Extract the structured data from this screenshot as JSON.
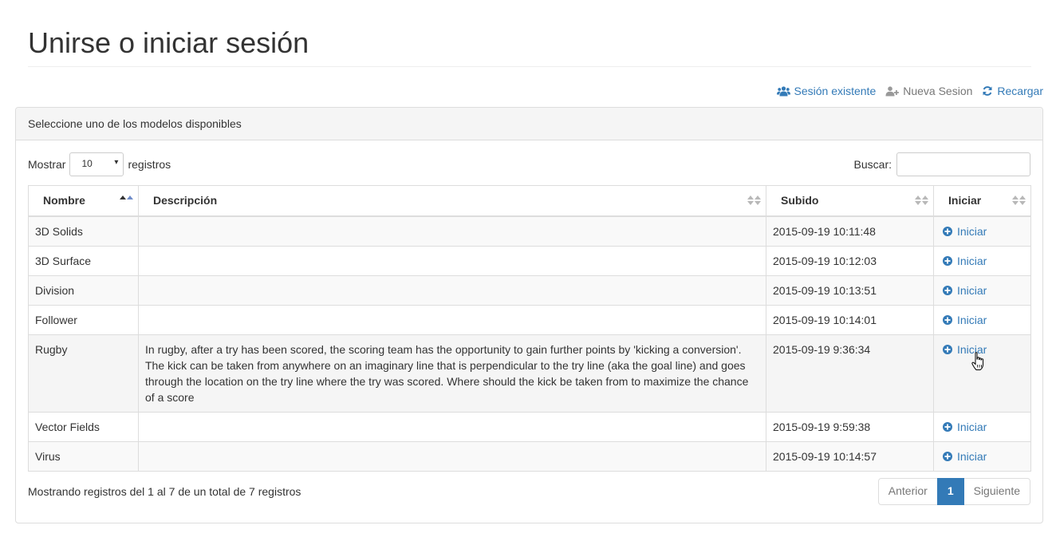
{
  "page": {
    "title": "Unirse o iniciar sesión"
  },
  "toolbar": {
    "existing_session": "Sesión existente",
    "new_session": "Nueva Sesion",
    "reload": "Recargar"
  },
  "panel": {
    "heading": "Seleccione uno de los modelos disponibles"
  },
  "table_controls": {
    "show_label": "Mostrar",
    "page_size": "10",
    "records_label": "registros",
    "search_label": "Buscar:",
    "search_value": ""
  },
  "table": {
    "columns": [
      "Nombre",
      "Descripción",
      "Subido",
      "Iniciar"
    ],
    "rows": [
      {
        "name": "3D Solids",
        "description": "",
        "uploaded": "2015-09-19 10:11:48",
        "action": "Iniciar"
      },
      {
        "name": "3D Surface",
        "description": "",
        "uploaded": "2015-09-19 10:12:03",
        "action": "Iniciar"
      },
      {
        "name": "Division",
        "description": "",
        "uploaded": "2015-09-19 10:13:51",
        "action": "Iniciar"
      },
      {
        "name": "Follower",
        "description": "",
        "uploaded": "2015-09-19 10:14:01",
        "action": "Iniciar"
      },
      {
        "name": "Rugby",
        "description": "In rugby, after a try has been scored, the scoring team has the opportunity to gain further points by 'kicking a conversion'. The kick can be taken from anywhere on an imaginary line that is perpendicular to the try line (aka the goal line) and goes through the location on the try line where the try was scored. Where should the kick be taken from to maximize the chance of a score",
        "uploaded": "2015-09-19 9:36:34",
        "action": "Iniciar"
      },
      {
        "name": "Vector Fields",
        "description": "",
        "uploaded": "2015-09-19 9:59:38",
        "action": "Iniciar"
      },
      {
        "name": "Virus",
        "description": "",
        "uploaded": "2015-09-19 10:14:57",
        "action": "Iniciar"
      }
    ]
  },
  "footer": {
    "info": "Mostrando registros del 1 al 7 de un total de 7 registros",
    "prev": "Anterior",
    "page": "1",
    "next": "Siguiente"
  },
  "colors": {
    "link": "#337ab7",
    "muted": "#777777",
    "active_page": "#337ab7"
  }
}
